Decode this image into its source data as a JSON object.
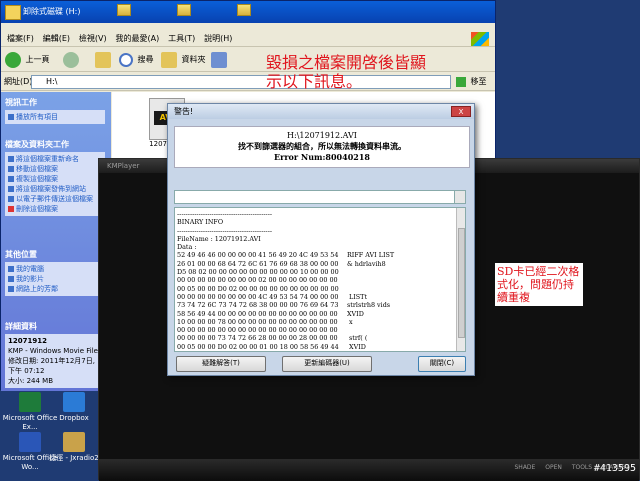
{
  "desktop": {
    "icons": [
      {
        "label": "Microsoft Office Ex..."
      },
      {
        "label": "Dropbox"
      },
      {
        "label": "Microsoft Office Wo..."
      },
      {
        "label": "捷徑 - Jxradio2"
      }
    ]
  },
  "explorer": {
    "title": "卸除式磁碟 (H:)",
    "menu": [
      "檔案(F)",
      "編輯(E)",
      "檢視(V)",
      "我的最愛(A)",
      "工具(T)",
      "說明(H)"
    ],
    "toolbar": {
      "back": "上一頁",
      "search": "搜尋",
      "folders": "資料夾"
    },
    "address_label": "網址(D)",
    "address_value": "H:\\",
    "go_label": "移至",
    "side": {
      "video_tasks_title": "視訊工作",
      "video_tasks": [
        "播放所有項目"
      ],
      "file_tasks_title": "檔案及資料夾工作",
      "file_tasks": [
        "將這個檔案重新命名",
        "移動這個檔案",
        "複製這個檔案",
        "將這個檔案發佈到網站",
        "以電子郵件傳送這個檔案",
        "刪除這個檔案"
      ],
      "other_title": "其他位置",
      "other": [
        "我的電腦",
        "我的影片",
        "網路上的芳鄰"
      ],
      "details_title": "詳細資料",
      "details": [
        "12071912",
        "KMP - Windows Movie File",
        "修改日期: 2011年12月7日, 下午 07:12",
        "大小: 244 MB"
      ]
    },
    "file": {
      "name": "12071912",
      "badge": "AVI"
    },
    "caption": "毀損之檔案開啓後皆顯示以下訊息。"
  },
  "player": {
    "title": "KMPlayer",
    "bottom_labels": [
      "SHADE",
      "OPEN",
      "TOOLS",
      "PLAYLIST"
    ],
    "right_glyph": "g)",
    "sd_note": "SD卡已經二次格式化，問題仍持續重複"
  },
  "dialog": {
    "title": "警告!",
    "close": "X",
    "heading": "H:\\12071912.AVI",
    "message": "找不到篩選器的組合，所以無法轉換資料串流。",
    "error": "Error Num:80040218",
    "info_lines": [
      {
        "hex": "--------------------------------------------",
        "txt": ""
      },
      {
        "hex": "BINARY INFO",
        "txt": ""
      },
      {
        "hex": "--------------------------------------------",
        "txt": ""
      },
      {
        "hex": "FileName : 12071912.AVI",
        "txt": ""
      },
      {
        "hex": "Data :",
        "txt": ""
      },
      {
        "hex": " 52 49 46 46 00 00 00 00 41 56 49 20 4C 49 53 54",
        "txt": "RIFF   AVI LIST"
      },
      {
        "hex": " 26 01 00 00 68 64 72 6C 61 76 69 68 38 00 00 00",
        "txt": "&   hdrlavih8"
      },
      {
        "hex": " D5 08 02 00 00 00 00 00 00 00 00 00 10 00 00 00",
        "txt": ""
      },
      {
        "hex": " 00 00 00 00 00 00 00 00 02 00 00 00 00 00 00 00",
        "txt": ""
      },
      {
        "hex": " 00 05 00 00 D0 02 00 00 00 00 00 00 00 00 00 00",
        "txt": ""
      },
      {
        "hex": " 00 00 00 00 00 00 00 00 4C 49 53 54 74 00 00 00",
        "txt": "           LISTt"
      },
      {
        "hex": " 73 74 72 6C 73 74 72 68 38 00 00 00 76 69 64 73",
        "txt": "strlstrh8   vids"
      },
      {
        "hex": " 58 56 49 44 00 00 00 00 00 00 00 00 00 00 00 00",
        "txt": "XVID"
      },
      {
        "hex": " 10 00 00 00 78 00 00 00 00 00 00 00 00 00 00 00",
        "txt": "      x"
      },
      {
        "hex": " 00 00 00 00 00 00 00 00 00 00 00 00 00 00 00 00",
        "txt": ""
      },
      {
        "hex": " 00 00 00 00 73 74 72 66 28 00 00 00 28 00 00 00",
        "txt": "    strf(   ("
      },
      {
        "hex": " 00 05 00 00 D0 02 00 00 01 00 18 00 58 56 49 44",
        "txt": "            XVID"
      }
    ],
    "buttons": {
      "solution": "疑難解答(T)",
      "update": "更新編碼器(U)",
      "close": "關閉(C)"
    }
  },
  "watermark": "#413595"
}
